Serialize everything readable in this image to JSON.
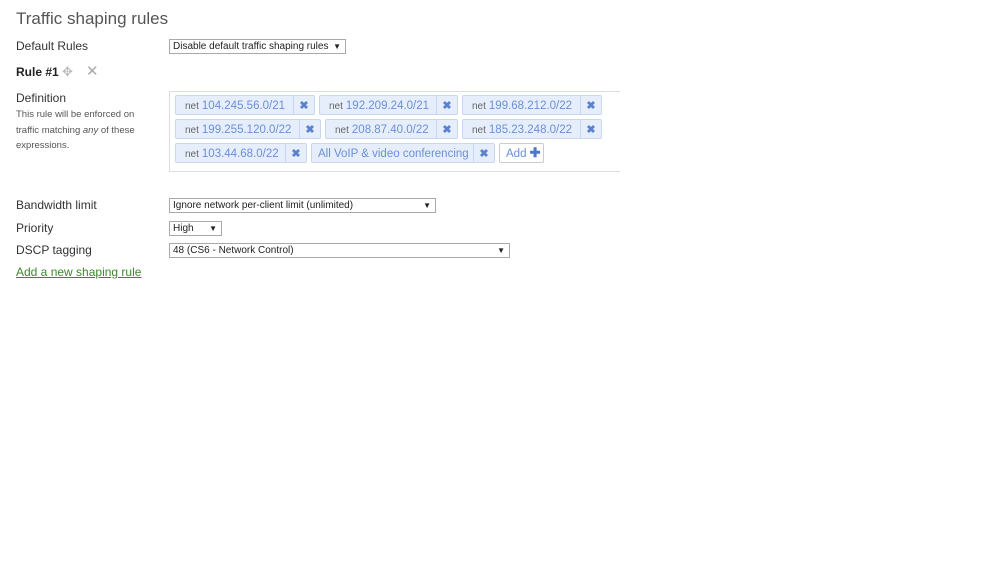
{
  "page": {
    "title": "Traffic shaping rules"
  },
  "default_rules": {
    "label": "Default Rules",
    "value": "Disable default traffic shaping rules"
  },
  "rule": {
    "title": "Rule #1",
    "definition_label": "Definition",
    "definition_desc_1": "This rule will be enforced on",
    "definition_desc_2": "traffic matching ",
    "definition_desc_em": "any",
    "definition_desc_3": " of these",
    "definition_desc_4": "expressions.",
    "tags": [
      {
        "kw": "net",
        "value": "104.245.56.0/21"
      },
      {
        "kw": "net",
        "value": "192.209.24.0/21"
      },
      {
        "kw": "net",
        "value": "199.68.212.0/22"
      },
      {
        "kw": "net",
        "value": "199.255.120.0/22"
      },
      {
        "kw": "net",
        "value": "208.87.40.0/22"
      },
      {
        "kw": "net",
        "value": "185.23.248.0/22"
      },
      {
        "kw": "net",
        "value": "103.44.68.0/22"
      },
      {
        "kw": "",
        "value": "All VoIP & video conferencing"
      }
    ],
    "remove_glyph": "✖",
    "add_label": "Add",
    "add_glyph": "✚"
  },
  "bandwidth": {
    "label": "Bandwidth limit",
    "value": "Ignore network per-client limit (unlimited)"
  },
  "priority": {
    "label": "Priority",
    "value": "High"
  },
  "dscp": {
    "label": "DSCP tagging",
    "value": "48 (CS6 - Network Control)"
  },
  "add_rule_link": "Add a new shaping rule",
  "icons": {
    "dropdown": "▼",
    "move": "✥",
    "delete": "✕"
  }
}
